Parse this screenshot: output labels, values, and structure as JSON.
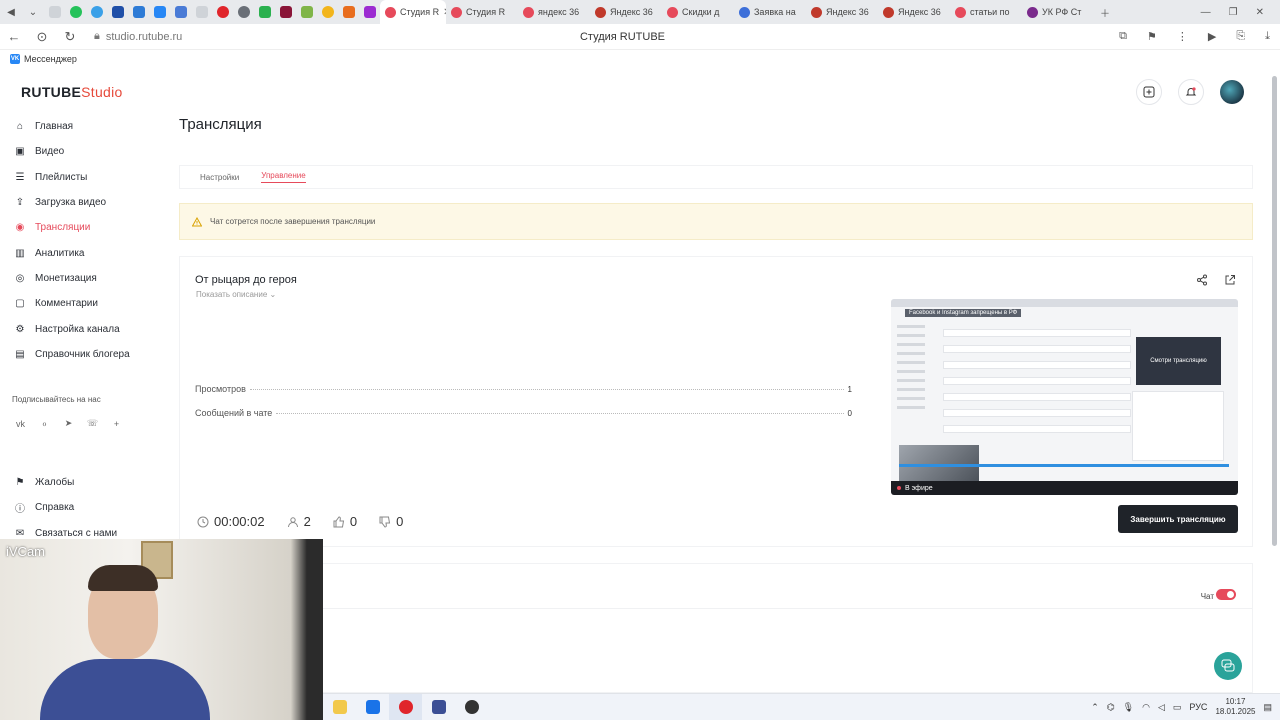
{
  "browser": {
    "tabs": [
      {
        "label": "Студия R",
        "color": "#e64a5b",
        "active": true
      },
      {
        "label": "Студия R",
        "color": "#e64a5b"
      },
      {
        "label": "яндекс 36",
        "color": "#e64a5b"
      },
      {
        "label": "Яндекс 36",
        "color": "#c0392b"
      },
      {
        "label": "Скидки д",
        "color": "#e64a5b"
      },
      {
        "label": "Заявка на",
        "color": "#3d6fd9"
      },
      {
        "label": "Яндекс 36",
        "color": "#c0392b"
      },
      {
        "label": "Яндекс 36",
        "color": "#c0392b"
      },
      {
        "label": "статьи по",
        "color": "#e64a5b"
      },
      {
        "label": "УК РФ Ст",
        "color": "#7a2a8c"
      }
    ],
    "url": "studio.rutube.ru",
    "page_title": "Студия RUTUBE",
    "bookmark": "Мессенджер"
  },
  "app": {
    "logo_main": "RUTUBE",
    "logo_studio": "Studio"
  },
  "sidebar": {
    "items": [
      {
        "label": "Главная",
        "icon": "home-icon"
      },
      {
        "label": "Видео",
        "icon": "video-icon"
      },
      {
        "label": "Плейлисты",
        "icon": "playlist-icon"
      },
      {
        "label": "Загрузка видео",
        "icon": "upload-icon"
      },
      {
        "label": "Трансляции",
        "icon": "broadcast-icon",
        "active": true
      },
      {
        "label": "Аналитика",
        "icon": "analytics-icon"
      },
      {
        "label": "Монетизация",
        "icon": "money-icon"
      },
      {
        "label": "Комментарии",
        "icon": "comment-icon"
      },
      {
        "label": "Настройка канала",
        "icon": "gear-icon"
      },
      {
        "label": "Справочник блогера",
        "icon": "book-icon"
      }
    ],
    "subscribe_label": "Подписывайтесь на нас",
    "bottom_items": [
      {
        "label": "Жалобы",
        "icon": "flag-icon"
      },
      {
        "label": "Справка",
        "icon": "help-icon"
      },
      {
        "label": "Связаться с нами",
        "icon": "mail-icon"
      }
    ]
  },
  "main": {
    "title": "Трансляция",
    "tabs": [
      "Настройки",
      "Управление"
    ],
    "active_tab": "Управление",
    "alert": "Чат сотрется после завершения трансляции",
    "stream": {
      "title": "От рыцаря до героя",
      "show_description": "Показать описание",
      "stats": [
        {
          "label": "Просмотров",
          "value": "1"
        },
        {
          "label": "Сообщений в чате",
          "value": "0"
        }
      ],
      "timer": "00:00:02",
      "viewers": "2",
      "likes": "0",
      "dislikes": "0",
      "end_button": "Завершить трансляцию",
      "preview": {
        "notice": "Facebook и Instagram запрещены в РФ",
        "card_text": "Смотри трансляцию",
        "live_label": "В эфире"
      }
    },
    "chat_label": "Чат"
  },
  "webcam": {
    "label": "iVCam"
  },
  "taskbar": {
    "lang": "РУС",
    "time": "10:17",
    "date": "18.01.2025"
  }
}
